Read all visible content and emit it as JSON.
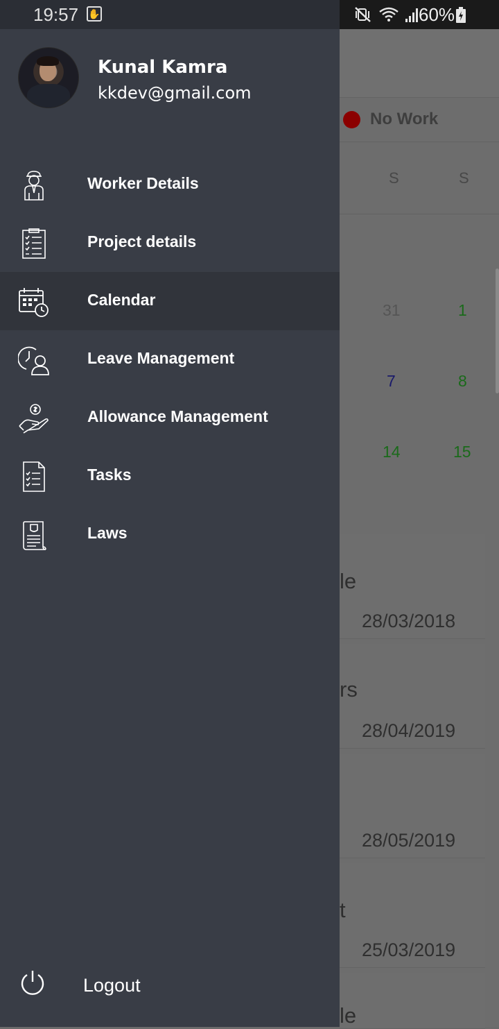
{
  "status_bar": {
    "time": "19:57",
    "app_icon": "hand-icon",
    "battery": "60%",
    "icons": [
      "mute-vibrate-icon",
      "wifi-icon",
      "signal-icon",
      "battery-charging-icon"
    ]
  },
  "drawer": {
    "user": {
      "name": "Kunal Kamra",
      "email": "kkdev@gmail.com"
    },
    "menu": [
      {
        "label": "Worker Details",
        "icon": "worker-icon",
        "active": false
      },
      {
        "label": "Project details",
        "icon": "clipboard-checklist-icon",
        "active": false
      },
      {
        "label": "Calendar",
        "icon": "calendar-clock-icon",
        "active": true
      },
      {
        "label": "Leave Management",
        "icon": "person-clock-icon",
        "active": false
      },
      {
        "label": "Allowance Management",
        "icon": "hand-money-icon",
        "active": false
      },
      {
        "label": "Tasks",
        "icon": "task-list-icon",
        "active": false
      },
      {
        "label": "Laws",
        "icon": "law-scroll-icon",
        "active": false
      }
    ],
    "logout_label": "Logout"
  },
  "background": {
    "legend": {
      "label": "No Work",
      "color": "#8b0000"
    },
    "days": [
      "S",
      "S"
    ],
    "calendar_rows": [
      [
        {
          "n": "31",
          "color": "#555555"
        },
        {
          "n": "1",
          "color": "#1a6a1a"
        }
      ],
      [
        {
          "n": "7",
          "color": "#1a1a6a"
        },
        {
          "n": "8",
          "color": "#1a6a1a"
        }
      ],
      [
        {
          "n": "14",
          "color": "#1a6a1a"
        },
        {
          "n": "15",
          "color": "#1a6a1a"
        }
      ]
    ],
    "cards": [
      {
        "title": "le",
        "date": "28/03/2018"
      },
      {
        "title": "rs",
        "date": "28/04/2019"
      },
      {
        "title": "",
        "date": "28/05/2019"
      },
      {
        "title": "t",
        "date": "25/03/2019"
      },
      {
        "title": "le",
        "date": ""
      }
    ]
  }
}
